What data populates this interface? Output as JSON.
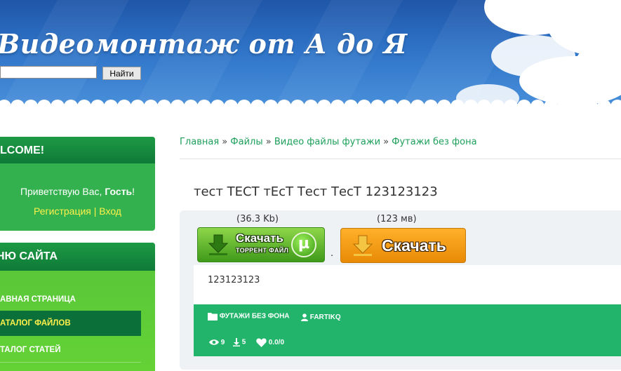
{
  "header": {
    "site_title": "Видеомонтаж от А до Я",
    "search": {
      "value": "",
      "placeholder": "",
      "button_label": "Найти"
    }
  },
  "sidebar": {
    "welcome": {
      "title": "LCOME!",
      "greeting_prefix": "Приветствую Вас, ",
      "greeting_name": "Гость",
      "greeting_suffix": "!",
      "register_label": "Регистрация",
      "separator": "|",
      "login_label": "Вход"
    },
    "menu": {
      "title": "НЮ САЙТА",
      "items": [
        {
          "label": "авная страница",
          "active": false
        },
        {
          "label": "аталог файлов",
          "active": true
        },
        {
          "label": "талог статей",
          "active": false
        }
      ]
    }
  },
  "main": {
    "breadcrumb": [
      "Главная",
      "Файлы",
      "Видео файлы футажи",
      "Футажи без фона"
    ],
    "breadcrumb_sep": "»",
    "entry_title": "тест ТЕСТ тЕсТ Тест ТесТ 123123123",
    "downloads": {
      "torrent_size": "(36.3 Kb)",
      "torrent_line1": "Скачать",
      "torrent_line2": "ТОРРЕНТ ФАЙЛ",
      "separator": ".",
      "direct_size": "(123 мв)",
      "direct_label": "Скачать"
    },
    "description": "123123123",
    "meta": {
      "category": "ФУТАЖИ БЕЗ ФОНА",
      "author": "FARTIKQ",
      "views": "9",
      "downloads": "5",
      "rating": "0.0/0"
    }
  },
  "colors": {
    "accent_green": "#21b46a",
    "link_green": "#1d9f5a",
    "link_yellow": "#fff04a",
    "torrent_button": "#3f9a1a",
    "download_button": "#e88a06"
  }
}
